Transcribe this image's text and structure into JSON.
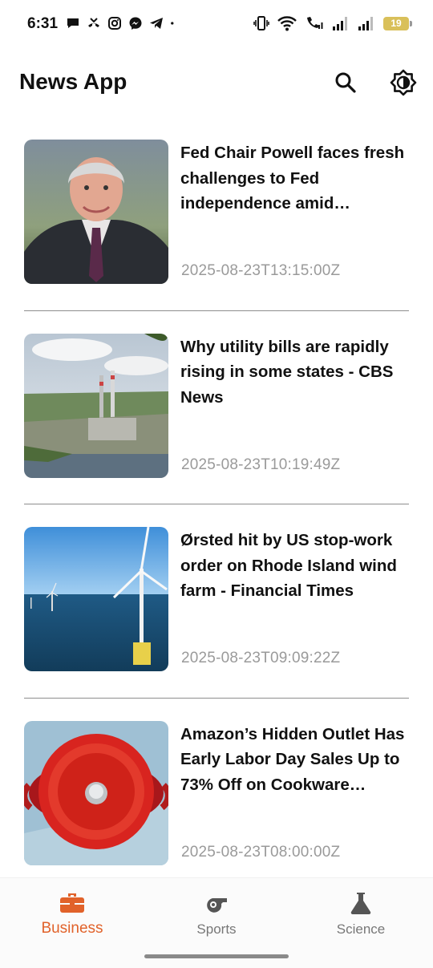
{
  "status_bar": {
    "time": "6:31",
    "battery": "19",
    "left_icons": [
      "chat-bubble-icon",
      "missed-call-icon",
      "instagram-icon",
      "messenger-icon",
      "telegram-icon",
      "dot-icon"
    ],
    "right_icons": [
      "vibrate-icon",
      "wifi-icon",
      "wifi-calling-icon",
      "signal-icon",
      "signal-icon"
    ]
  },
  "app_bar": {
    "title": "News App",
    "actions": [
      "search-icon",
      "brightness-icon"
    ]
  },
  "articles": [
    {
      "title": "Fed Chair Powell faces fresh challenges to Fed independence amid potential…",
      "date": "2025-08-23T13:15:00Z",
      "thumb": "portrait"
    },
    {
      "title": "Why utility bills are rapidly rising in some states - CBS News",
      "date": "2025-08-23T10:19:49Z",
      "thumb": "power-plant"
    },
    {
      "title": "Ørsted hit by US stop-work order on Rhode Island wind farm - Financial Times",
      "date": "2025-08-23T09:09:22Z",
      "thumb": "wind-turbine"
    },
    {
      "title": "Amazon’s Hidden Outlet Has Early Labor Day Sales Up to 73% Off on Cookware…",
      "date": "2025-08-23T08:00:00Z",
      "thumb": "dutch-oven"
    }
  ],
  "bottom_nav": {
    "items": [
      {
        "label": "Business",
        "icon": "briefcase-icon",
        "active": true
      },
      {
        "label": "Sports",
        "icon": "whistle-icon",
        "active": false
      },
      {
        "label": "Science",
        "icon": "flask-icon",
        "active": false
      }
    ]
  },
  "colors": {
    "accent": "#e1622a",
    "inactive": "#777777",
    "date_text": "#9a9a9a"
  }
}
